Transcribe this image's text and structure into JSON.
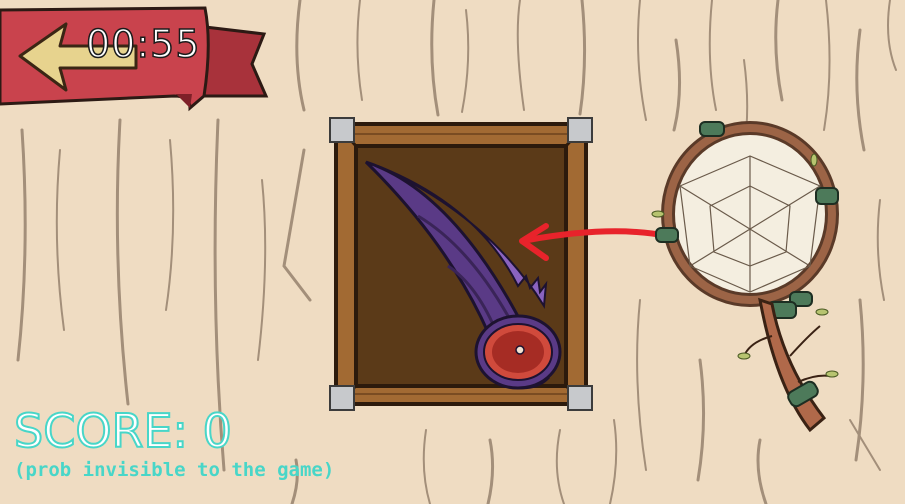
{
  "hud": {
    "timer": "00:55",
    "score_text": "SCORE: 0",
    "score_note": "(prob invisible to the game)"
  },
  "icons": {
    "back": "left-arrow-icon",
    "item": "purple-horn-icon",
    "tool": "dream-net-icon"
  },
  "colors": {
    "background": "#efdcc2",
    "banner": "#c9434d",
    "arrow_hint": "#e8232b",
    "score_outline": "#48d6c8",
    "crate_inner": "#5b3a18",
    "horn": "#5a3a86"
  }
}
